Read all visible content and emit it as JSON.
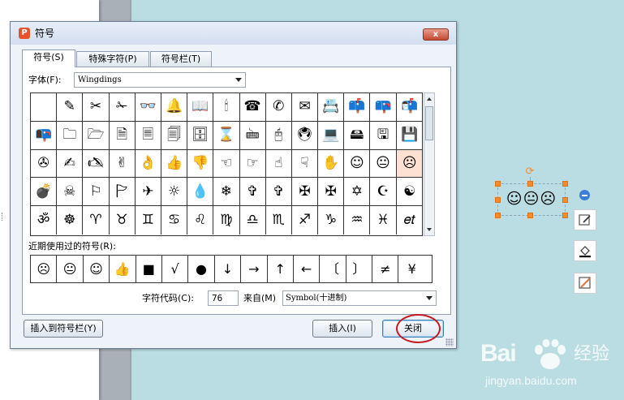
{
  "dialog": {
    "title": "符号",
    "close_glyph": "x",
    "tabs": [
      "符号(S)",
      "特殊字符(P)",
      "符号栏(T)"
    ],
    "font_label": "字体(F):",
    "font_value": "Wingdings",
    "recent_label": "近期使用过的符号(R):",
    "char_code_label": "字符代码(C):",
    "char_code_value": "76",
    "from_label": "来自(M)",
    "from_value": "Symbol(十进制)",
    "insert_to_bar_button": "插入到符号栏(Y)",
    "insert_button": "插入(I)",
    "close_button": "关闭"
  },
  "symbols": [
    [
      "",
      "✎",
      "✂",
      "✁",
      "👓",
      "🔔",
      "📖",
      "🕯",
      "☎",
      "✆",
      "✉",
      "📇",
      "📫",
      "📪",
      "📬"
    ],
    [
      "📭",
      "🗀",
      "🗁",
      "🗎",
      "🗏",
      "🗐",
      "🗄",
      "⌛",
      "🖮",
      "🖰",
      "🖲",
      "💻",
      "🖴",
      "🖫",
      "💾"
    ],
    [
      "✇",
      "✍",
      "🖎",
      "✌",
      "👌",
      "👍",
      "👎",
      "☜",
      "☞",
      "☝",
      "☟",
      "✋",
      "☺",
      "😐",
      "☹"
    ],
    [
      "💣",
      "☠",
      "⚐",
      "🏱",
      "✈",
      "☼",
      "💧",
      "❄",
      "✞",
      "✞",
      "✠",
      "✠",
      "✡",
      "☪",
      "☯"
    ],
    [
      "ॐ",
      "☸",
      "♈",
      "♉",
      "♊",
      "♋",
      "♌",
      "♍",
      "♎",
      "♏",
      "♐",
      "♑",
      "♒",
      "♓",
      "𝑒𝑡"
    ]
  ],
  "recent_symbols": [
    "☹",
    "😐",
    "☺",
    "👍",
    "■",
    "√",
    "●",
    "↓",
    "→",
    "↑",
    "←",
    "〔",
    "〕",
    "≠",
    "¥"
  ],
  "slide": {
    "shape_faces": "☺😐☹"
  },
  "watermark": {
    "brand": "Bai",
    "cn": "经验",
    "url": "jingyan.baidu.com"
  }
}
